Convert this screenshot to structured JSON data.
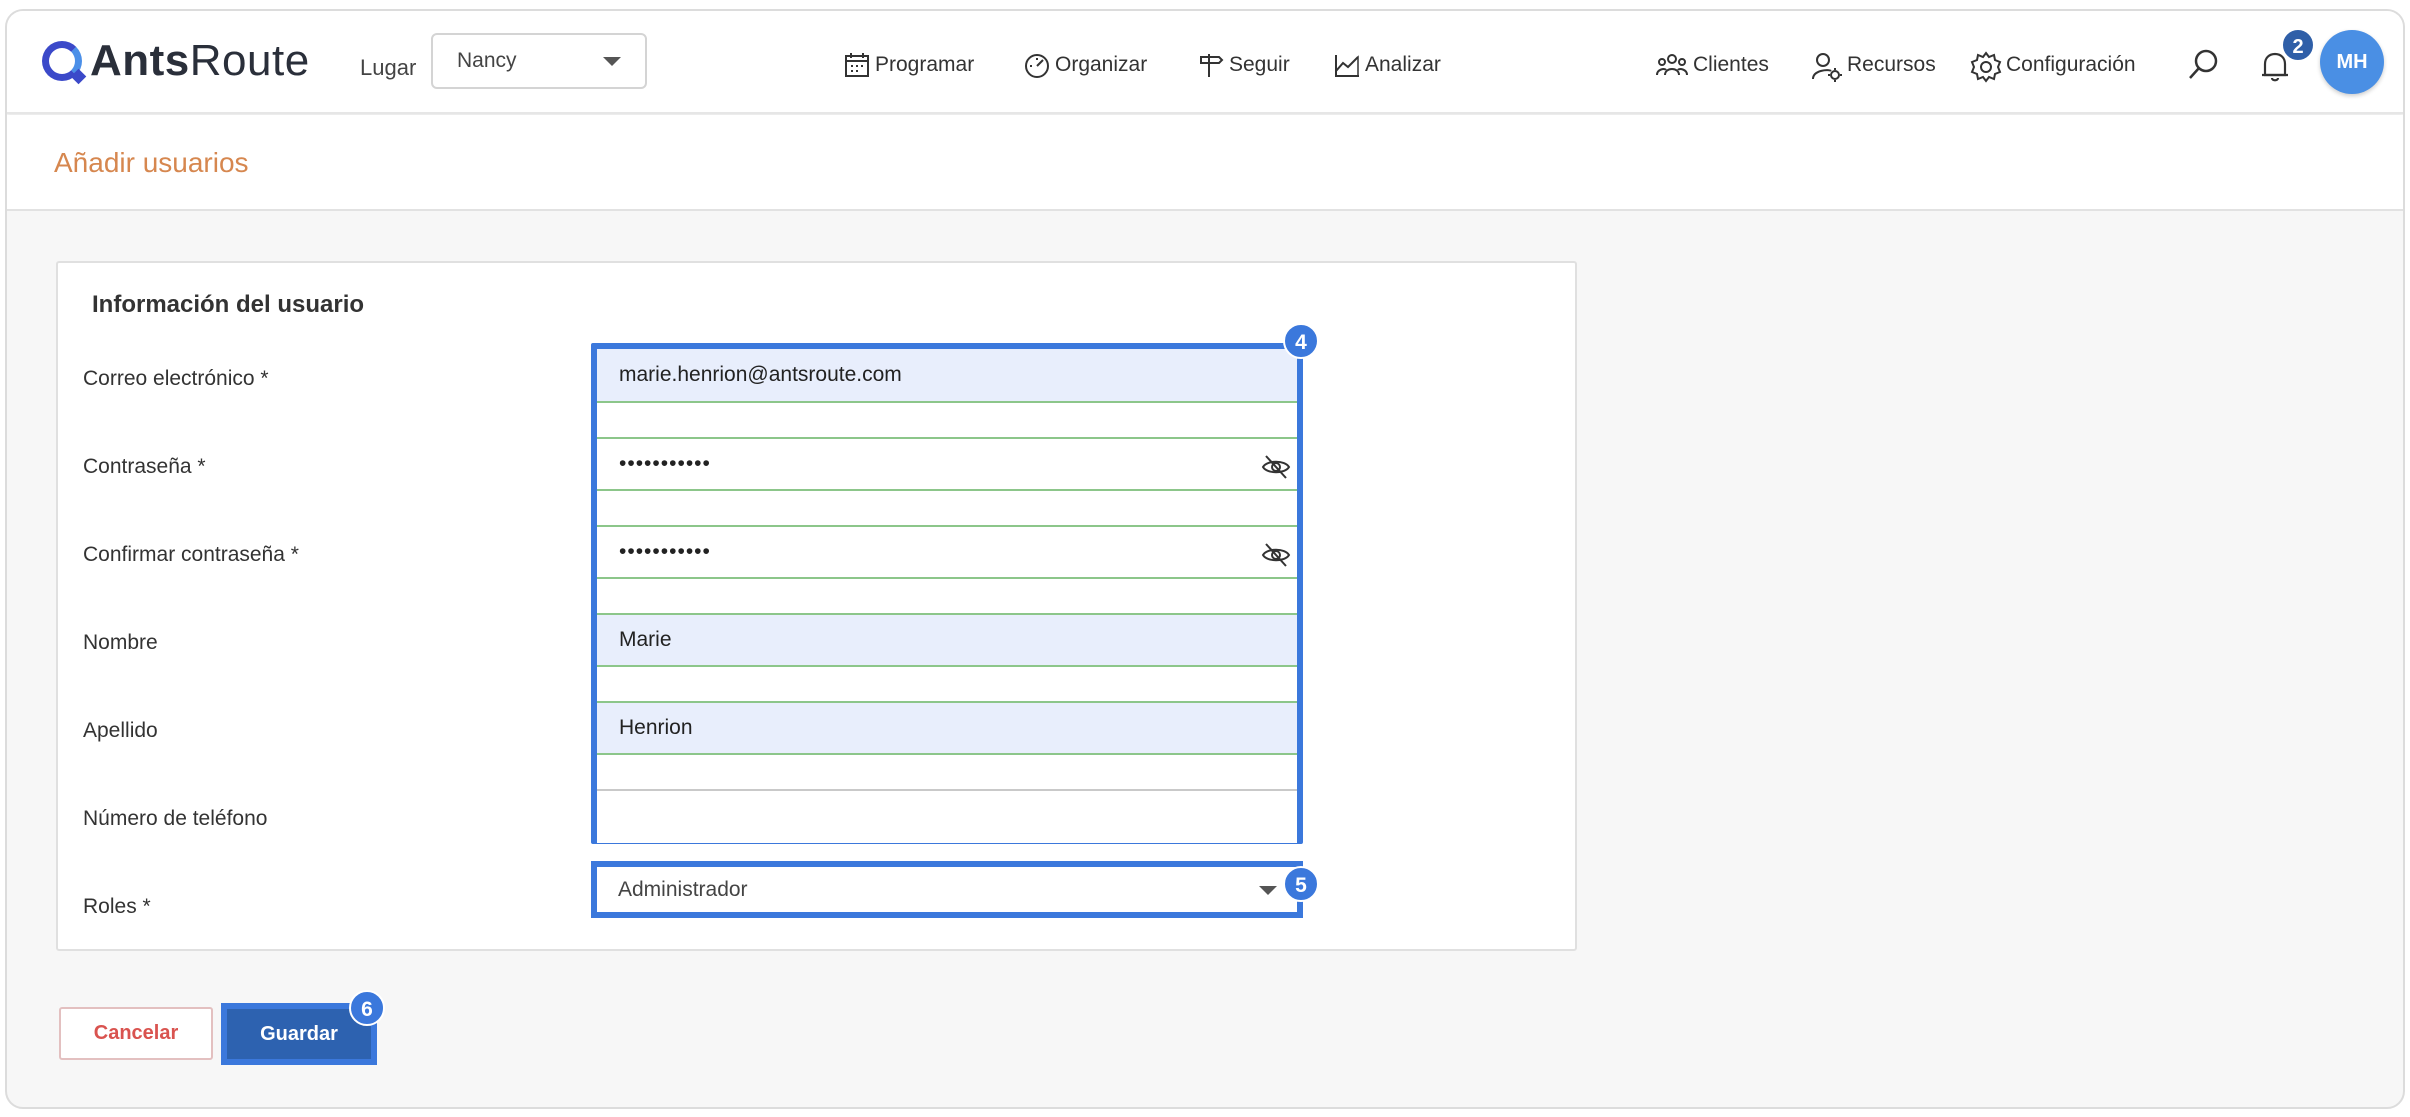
{
  "brand": {
    "name_bold": "Ants",
    "name_light": "Route"
  },
  "header": {
    "lugar_label": "Lugar",
    "lugar_value": "Nancy",
    "nav": [
      {
        "label": "Programar",
        "icon": "calendar-icon"
      },
      {
        "label": "Organizar",
        "icon": "gauge-icon"
      },
      {
        "label": "Seguir",
        "icon": "signpost-icon"
      },
      {
        "label": "Analizar",
        "icon": "chart-icon"
      }
    ],
    "right_nav": [
      {
        "label": "Clientes",
        "icon": "clients-icon"
      },
      {
        "label": "Recursos",
        "icon": "resources-icon"
      },
      {
        "label": "Configuración",
        "icon": "gear-icon"
      }
    ],
    "notification_count": "2",
    "avatar_initials": "MH"
  },
  "page": {
    "title": "Añadir usuarios"
  },
  "form": {
    "section_title": "Información del usuario",
    "email_label": "Correo electrónico *",
    "email_value": "marie.henrion@antsroute.com",
    "password_label": "Contraseña *",
    "password_value": "•••••••••••",
    "confirm_label": "Confirmar contraseña *",
    "confirm_value": "•••••••••••",
    "first_name_label": "Nombre",
    "first_name_value": "Marie",
    "last_name_label": "Apellido",
    "last_name_value": "Henrion",
    "phone_label": "Número de teléfono",
    "phone_value": "",
    "roles_label": "Roles *",
    "roles_value": "Administrador"
  },
  "actions": {
    "cancel": "Cancelar",
    "save": "Guardar"
  },
  "steps": {
    "fields": "4",
    "roles": "5",
    "save": "6"
  },
  "colors": {
    "accent": "#3b78dc",
    "title": "#d6874f",
    "save": "#2d62b0",
    "cancel": "#d9534f"
  }
}
